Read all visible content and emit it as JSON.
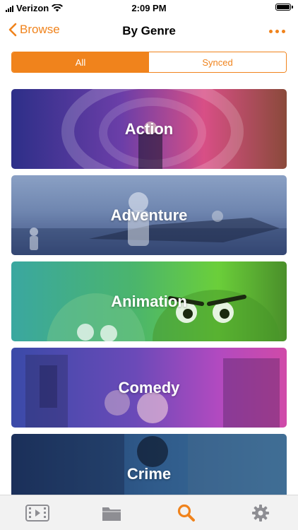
{
  "status": {
    "carrier": "Verizon",
    "time": "2:09 PM"
  },
  "nav": {
    "back_label": "Browse",
    "title": "By Genre"
  },
  "segments": [
    {
      "label": "All",
      "selected": true
    },
    {
      "label": "Synced",
      "selected": false
    }
  ],
  "genres": [
    {
      "label": "Action"
    },
    {
      "label": "Adventure"
    },
    {
      "label": "Animation"
    },
    {
      "label": "Comedy"
    },
    {
      "label": "Crime"
    }
  ],
  "tabbar": {
    "items": [
      {
        "icon": "video-icon",
        "selected": false
      },
      {
        "icon": "folder-icon",
        "selected": false
      },
      {
        "icon": "search-icon",
        "selected": true
      },
      {
        "icon": "gear-icon",
        "selected": false
      }
    ]
  },
  "colors": {
    "accent": "#f0831c",
    "inactive_icon": "#8e8e93"
  }
}
